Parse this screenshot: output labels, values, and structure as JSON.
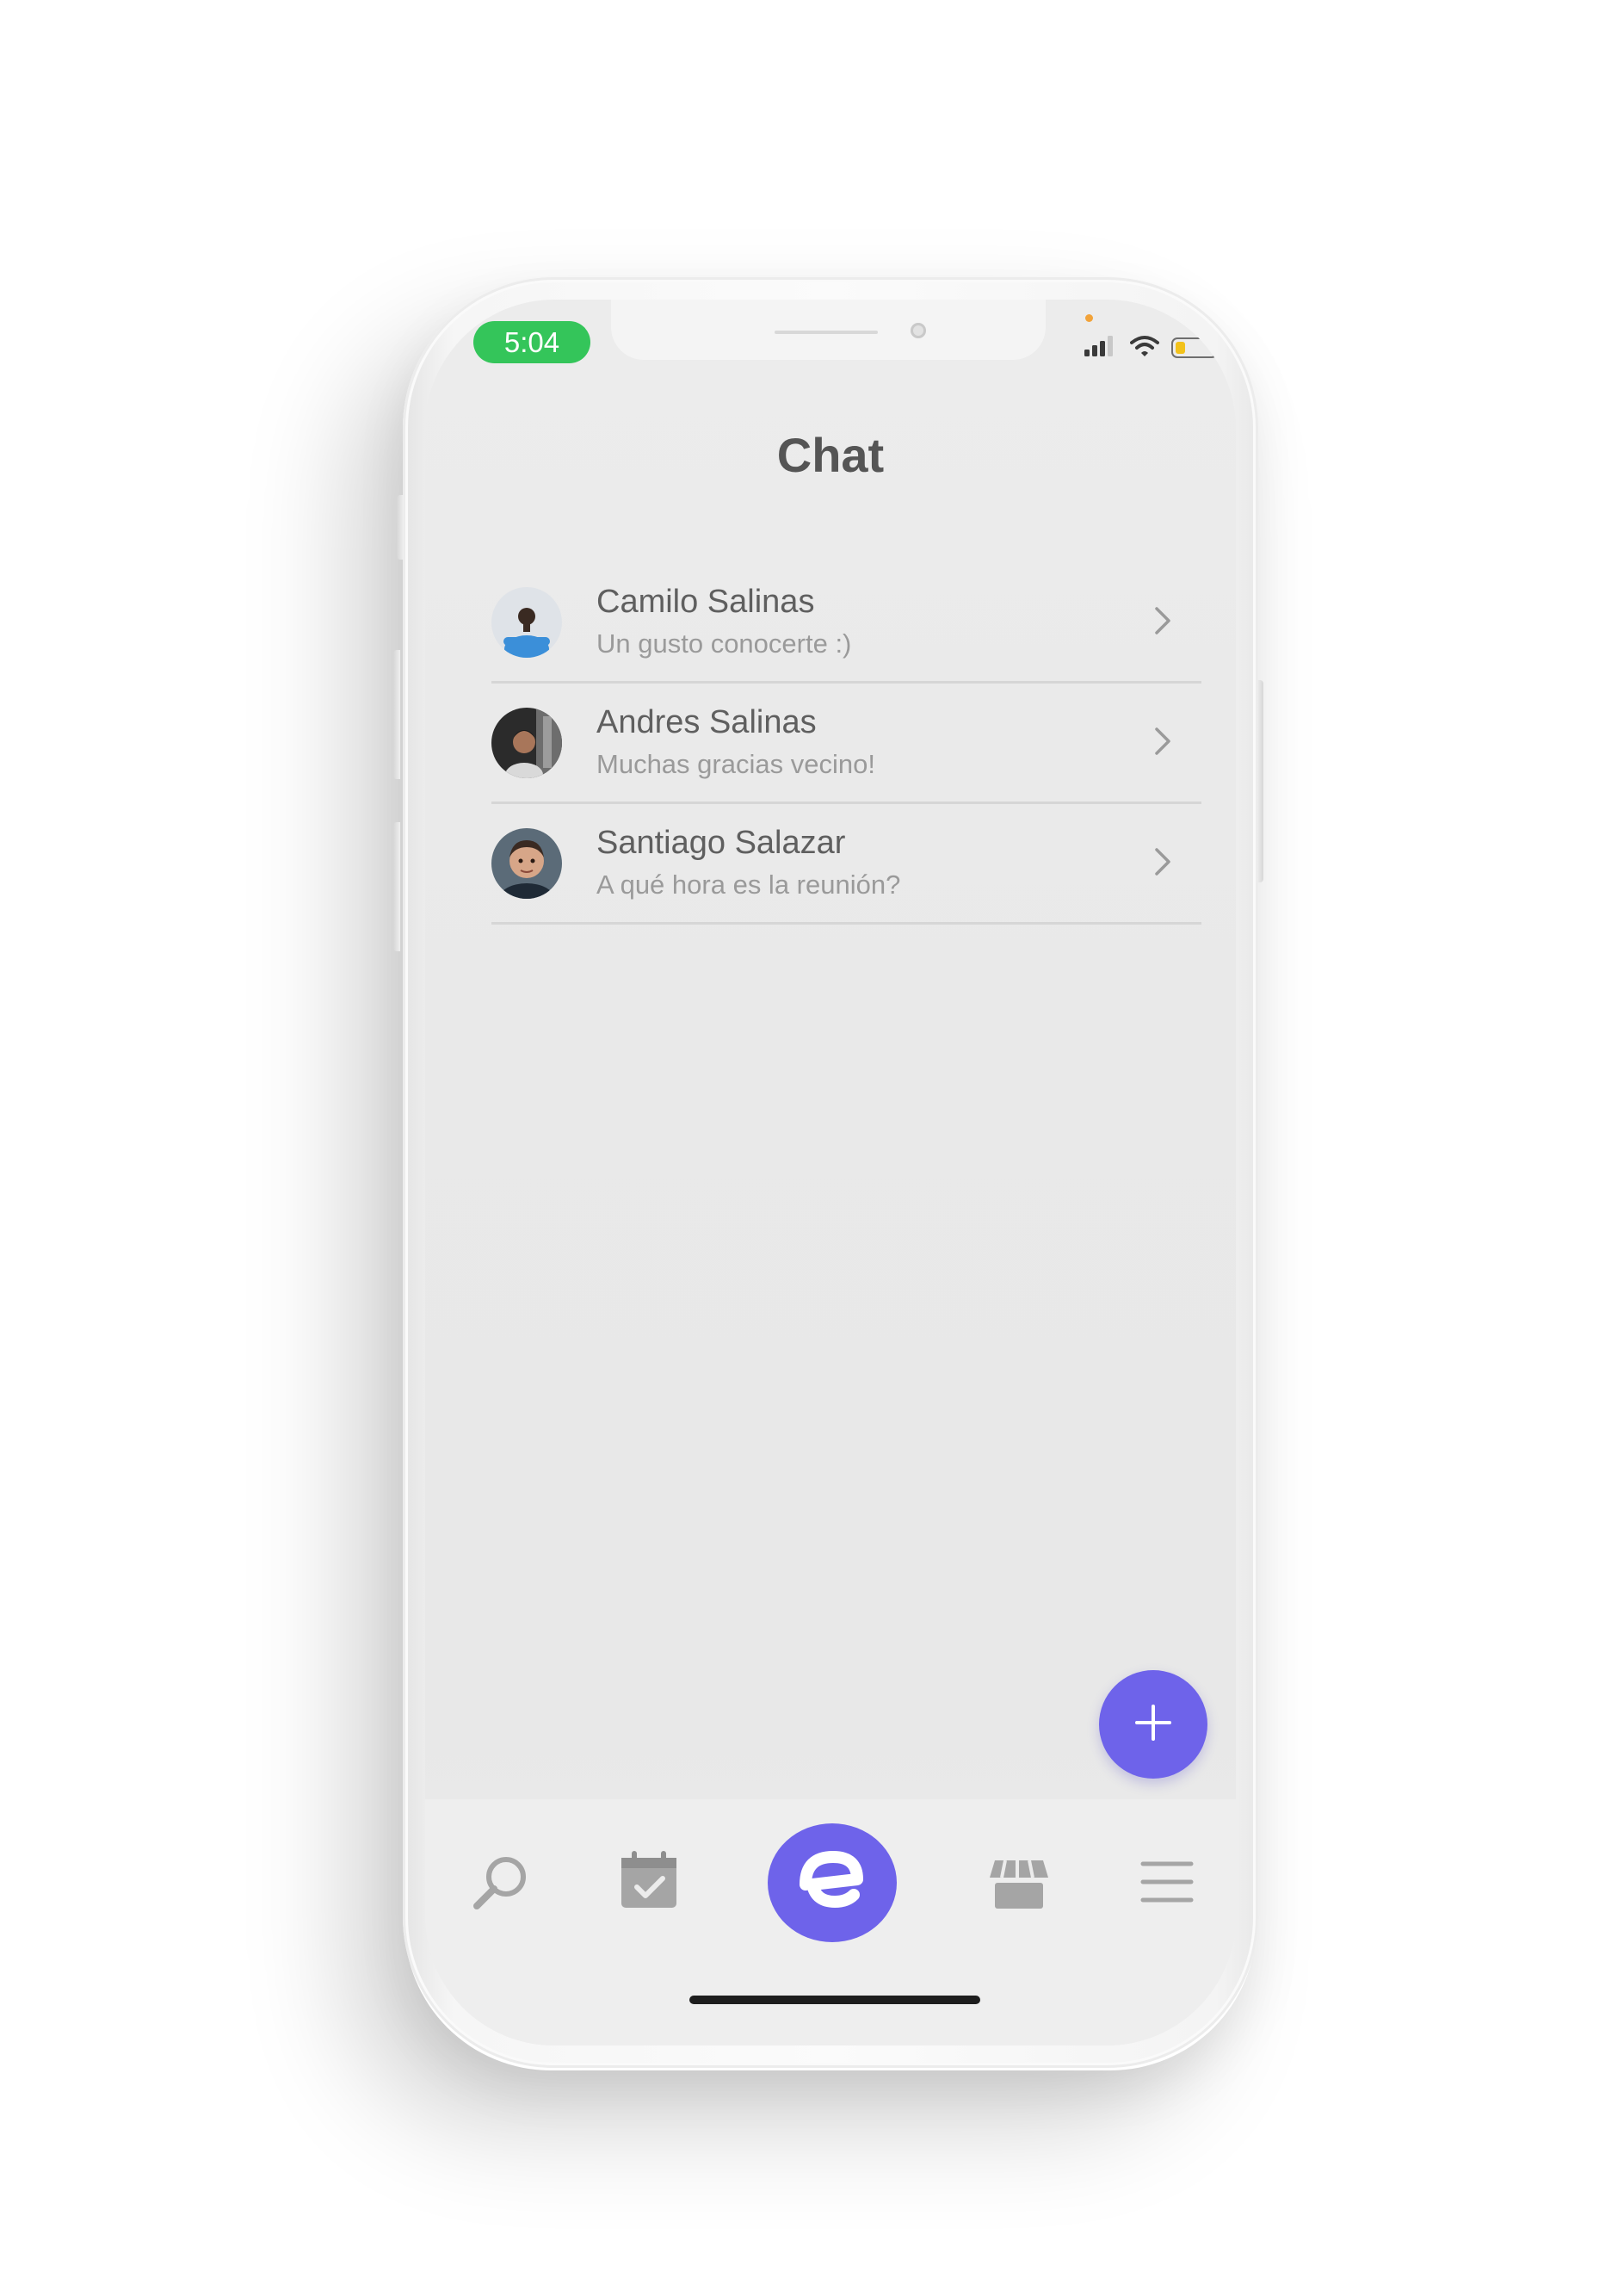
{
  "status_bar": {
    "time": "5:04",
    "battery_level": 0.25,
    "battery_color": "#f2c21b",
    "time_pill_color": "#34c55a",
    "icons": [
      "signal-icon",
      "wifi-icon",
      "battery-icon"
    ]
  },
  "header": {
    "title": "Chat"
  },
  "chats": [
    {
      "name": "Camilo Salinas",
      "message": "Un gusto conocerte :)",
      "avatar": "avatar-camilo"
    },
    {
      "name": "Andres Salinas",
      "message": "Muchas gracias vecino!",
      "avatar": "avatar-andres"
    },
    {
      "name": "Santiago Salazar",
      "message": "A qué hora es la reunión?",
      "avatar": "avatar-santiago"
    }
  ],
  "fab": {
    "icon": "plus-icon",
    "color": "#6e63ea"
  },
  "tab_bar": {
    "tabs": [
      {
        "icon": "search-icon"
      },
      {
        "icon": "calendar-check-icon"
      },
      {
        "icon": "brand-logo-icon"
      },
      {
        "icon": "store-icon"
      },
      {
        "icon": "menu-icon"
      }
    ],
    "accent": "#6e63ea"
  }
}
